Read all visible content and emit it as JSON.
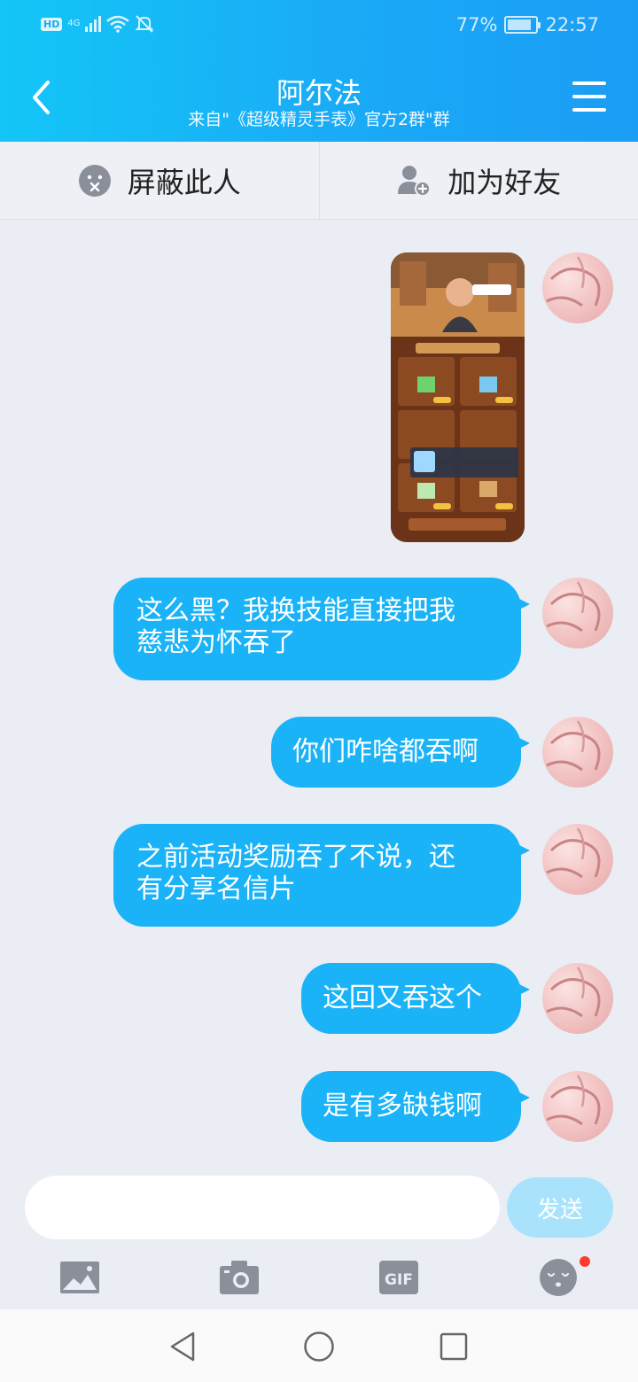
{
  "status_bar": {
    "hd": "HD",
    "network": "4G",
    "battery": "77%",
    "time": "22:57"
  },
  "header": {
    "title": "阿尔法",
    "subtitle": "来自\"《超级精灵手表》官方2群\"群",
    "back_icon": "chevron-left-icon",
    "menu_icon": "menu-icon"
  },
  "actions": {
    "block_label": "屏蔽此人",
    "add_friend_label": "加为好友"
  },
  "messages": [
    {
      "type": "image",
      "description_icon": "game-screenshot"
    },
    {
      "type": "text",
      "lines": [
        "这么黑？我换技能直接把我",
        "慈悲为怀吞了"
      ]
    },
    {
      "type": "text",
      "lines": [
        "你们咋啥都吞啊"
      ]
    },
    {
      "type": "text",
      "lines": [
        "之前活动奖励吞了不说，还",
        "有分享名信片"
      ]
    },
    {
      "type": "text",
      "lines": [
        "这回又吞这个"
      ]
    },
    {
      "type": "text",
      "lines": [
        "是有多缺钱啊"
      ]
    }
  ],
  "composer": {
    "input_value": "",
    "send_label": "发送",
    "gif_label": "GIF"
  },
  "colors": {
    "accent": "#1ab3f7",
    "header_start": "#13c6f7",
    "header_end": "#1b9df5",
    "background": "#eaedf4",
    "send_disabled": "#a8e3fb",
    "badge": "#ff3b30"
  }
}
